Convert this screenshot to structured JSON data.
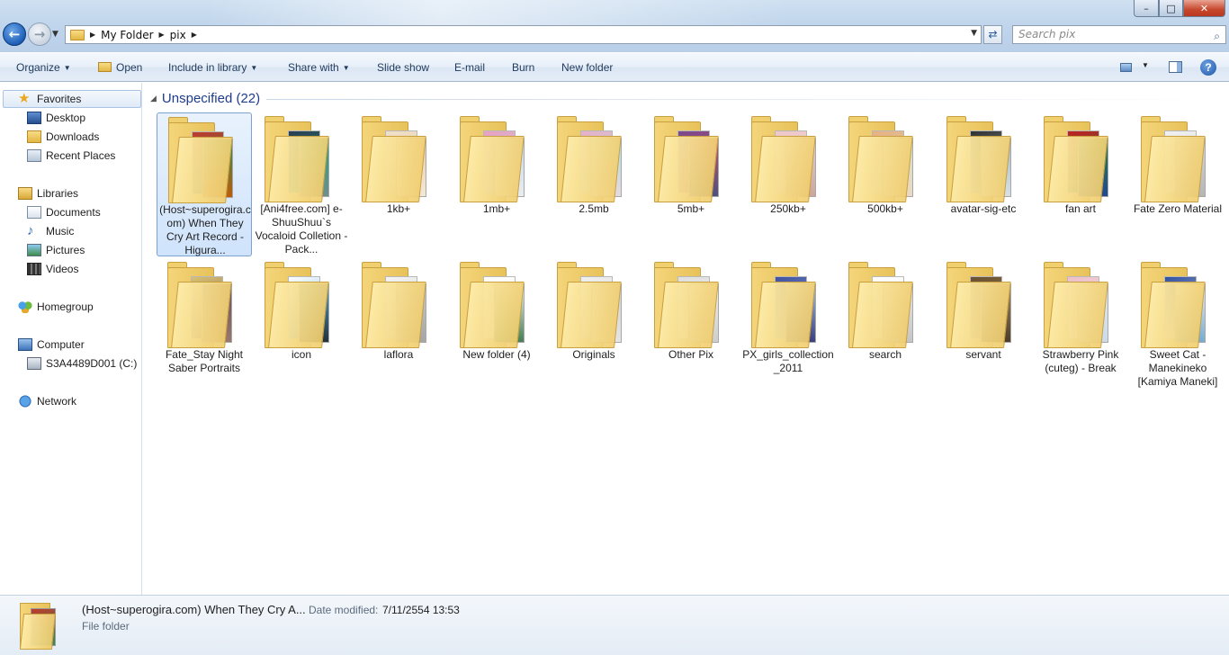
{
  "address": {
    "crumbs": [
      "My Folder",
      "pix"
    ]
  },
  "search": {
    "placeholder": "Search pix"
  },
  "toolbar": {
    "organize": "Organize",
    "open": "Open",
    "include_in_library": "Include in library",
    "share_with": "Share with",
    "slide_show": "Slide show",
    "email": "E-mail",
    "burn": "Burn",
    "new_folder": "New folder"
  },
  "navigation": {
    "favorites": "Favorites",
    "desktop": "Desktop",
    "downloads": "Downloads",
    "recent_places": "Recent Places",
    "libraries": "Libraries",
    "documents": "Documents",
    "music": "Music",
    "pictures": "Pictures",
    "videos": "Videos",
    "homegroup": "Homegroup",
    "computer": "Computer",
    "drive": "S3A4489D001 (C:)",
    "network": "Network"
  },
  "group": {
    "title": "Unspecified (22)"
  },
  "folders": [
    {
      "name": "(Host~superogira.com) When They Cry Art Record - Higura...",
      "selected": true,
      "colors": [
        "#c0392b",
        "#2e8b57",
        "#d35400"
      ]
    },
    {
      "name": "[Ani4free.com] e-ShuuShuu`s Vocaloid Colletion - Pack...",
      "selected": false,
      "colors": [
        "#2c3e50",
        "#16a085",
        "#7f8c8d"
      ]
    },
    {
      "name": "1kb+",
      "selected": false,
      "colors": [
        "#f0e0c8",
        "#e8c8a0",
        "#f5eee0"
      ]
    },
    {
      "name": "1mb+",
      "selected": false,
      "colors": [
        "#e8a0c0",
        "#c0d8f0",
        "#f0f0f0"
      ]
    },
    {
      "name": "2.5mb",
      "selected": false,
      "colors": [
        "#e8b0c8",
        "#a8e0e0",
        "#f0d8e0"
      ]
    },
    {
      "name": "5mb+",
      "selected": false,
      "colors": [
        "#7a4a8a",
        "#c05070",
        "#3a5080"
      ]
    },
    {
      "name": "250kb+",
      "selected": false,
      "colors": [
        "#f0c8c8",
        "#e0d0d8",
        "#c8a090"
      ]
    },
    {
      "name": "500kb+",
      "selected": false,
      "colors": [
        "#e8b080",
        "#d0e0d0",
        "#f0d8c0"
      ]
    },
    {
      "name": "avatar-sig-etc",
      "selected": false,
      "colors": [
        "#303030",
        "#a0b8c8",
        "#e0e8ec"
      ]
    },
    {
      "name": "fan art",
      "selected": false,
      "colors": [
        "#c02020",
        "#208040",
        "#2040a0"
      ]
    },
    {
      "name": "Fate Zero Material",
      "selected": false,
      "colors": [
        "#f0f0f0",
        "#d8d8d8",
        "#b0b0b0"
      ]
    },
    {
      "name": "Fate_Stay Night Saber Portraits",
      "selected": false,
      "colors": [
        "#d8c070",
        "#6a4a5a",
        "#a08070"
      ]
    },
    {
      "name": "icon",
      "selected": false,
      "colors": [
        "#ffffff",
        "#40a0d8",
        "#202020"
      ]
    },
    {
      "name": "laflora",
      "selected": false,
      "colors": [
        "#f4f4f4",
        "#c8c8c8",
        "#a0a0a0"
      ]
    },
    {
      "name": "New folder (4)",
      "selected": false,
      "colors": [
        "#ffffff",
        "#f4f4f4",
        "#2a6a3a"
      ]
    },
    {
      "name": "Originals",
      "selected": false,
      "colors": [
        "#f0f0f0",
        "#d0d0d0",
        "#e8e8e8"
      ]
    },
    {
      "name": "Other Pix",
      "selected": false,
      "colors": [
        "#e0e0e0",
        "#f0f0f0",
        "#c8c8c8"
      ]
    },
    {
      "name": "PX_girls_collection_2011",
      "selected": false,
      "colors": [
        "#4050a0",
        "#a0c0e8",
        "#2a2a6a"
      ]
    },
    {
      "name": "search",
      "selected": false,
      "colors": [
        "#ffffff",
        "#e8e8e8",
        "#c0c0c0"
      ]
    },
    {
      "name": "servant",
      "selected": false,
      "colors": [
        "#6a5030",
        "#a08a60",
        "#403020"
      ]
    },
    {
      "name": "Strawberry Pink (cuteg) - Break",
      "selected": false,
      "colors": [
        "#f0c0c8",
        "#e0e8f0",
        "#c8d8e8"
      ]
    },
    {
      "name": "Sweet Cat - Manekineko [Kamiya Maneki]",
      "selected": false,
      "colors": [
        "#3050a0",
        "#f0f0f0",
        "#60a0d0"
      ]
    }
  ],
  "details": {
    "name": "(Host~superogira.com) When They Cry A...",
    "date_label": "Date modified:",
    "date_value": "7/11/2554 13:53",
    "type": "File folder"
  },
  "window_controls": {
    "minimize": "–",
    "maximize": "□",
    "close": "✕"
  }
}
